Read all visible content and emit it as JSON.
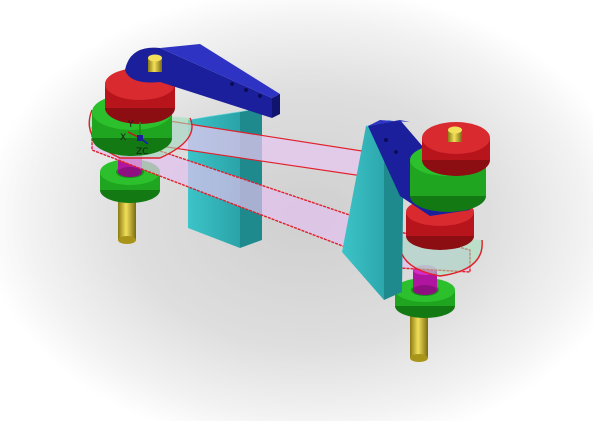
{
  "scene": {
    "description_free": true,
    "triad": {
      "x_label": "X",
      "y_label": "Y",
      "z_label": "ZC"
    },
    "colors": {
      "background_outer": "#ffffff",
      "background_inner": "#c8c8c8",
      "arm_blue": "#1b1f9c",
      "pulley_red": "#b8141c",
      "pulley_green": "#1fa51f",
      "hub_magenta": "#c21bb0",
      "shaft_yellow": "#c9b42a",
      "block_cyan": "#2fb1b6",
      "belt_fill": "#e8c8f0",
      "belt_edge": "#e0202a"
    }
  }
}
